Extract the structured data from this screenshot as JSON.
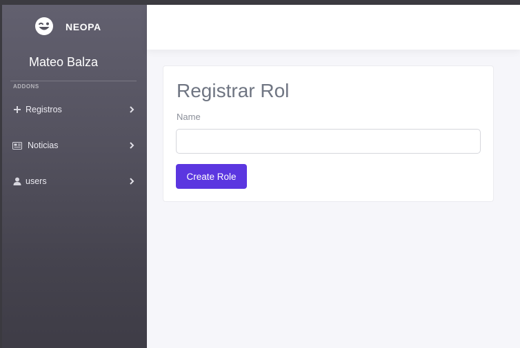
{
  "brand": {
    "name": "NEOPA",
    "logo_icon": "winking-face-icon"
  },
  "user": {
    "name": "Mateo Balza"
  },
  "sidebar": {
    "section_label": "ADDONS",
    "items": [
      {
        "label": "Registros",
        "icon": "plus-icon"
      },
      {
        "label": "Noticias",
        "icon": "newspaper-icon"
      },
      {
        "label": "users",
        "icon": "user-icon"
      }
    ]
  },
  "form": {
    "title": "Registrar Rol",
    "name_label": "Name",
    "name_value": "",
    "name_placeholder": "",
    "submit_label": "Create Role"
  },
  "colors": {
    "accent": "#5b36e0",
    "sidebar_top": "#62606f",
    "sidebar_bottom": "#3e3c46",
    "content_bg": "#f6f6fa"
  }
}
